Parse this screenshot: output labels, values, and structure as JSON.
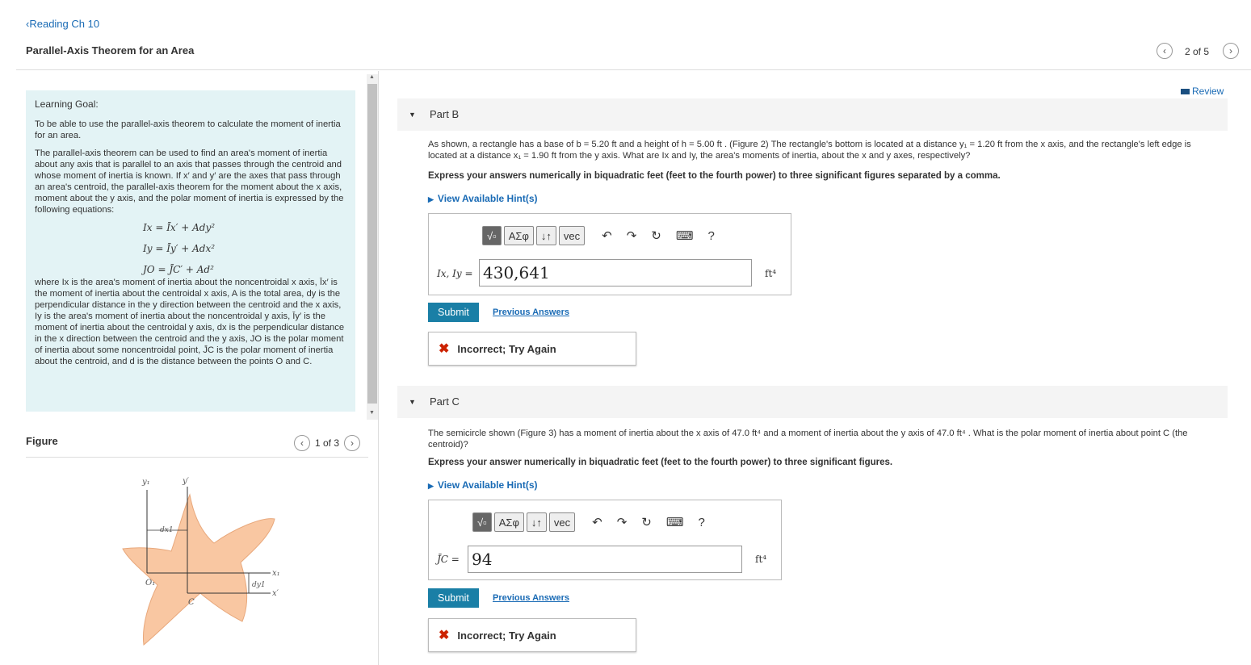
{
  "header": {
    "breadcrumb": "Reading Ch 10",
    "title": "Parallel-Axis Theorem for an Area",
    "pager": "2 of 5"
  },
  "review_label": "Review",
  "goal": {
    "title": "Learning Goal:",
    "p1": "To be able to use the parallel-axis theorem to calculate the moment of inertia for an area.",
    "p2": "The parallel-axis theorem can be used to find an area's moment of inertia about any axis that is parallel to an axis that passes through the centroid and whose moment of inertia is known. If x′ and y′ are the axes that pass through an area's centroid, the parallel-axis theorem for the moment about the x axis, moment about the y axis, and the polar moment of inertia is expressed by the following equations:",
    "eq1": "Ix = Īx′ + Ady²",
    "eq2": "Iy = Īy′ + Adx²",
    "eq3": "JO = J̄C′ + Ad²",
    "p3": "where Ix is the area's moment of inertia about the noncentroidal x axis, Īx′ is the moment of inertia about the centroidal x axis, A is the total area, dy is the perpendicular distance in the y direction between the centroid and the x axis, Iy is the area's moment of inertia about the noncentroidal y axis, Īy′ is the moment of inertia about the centroidal y axis, dx is the perpendicular distance in the x direction between the centroid and the y axis, JO is the polar moment of inertia about some noncentroidal point, J̄C is the polar moment of inertia about the centroid, and d is the distance between the points O and C."
  },
  "figure": {
    "heading": "Figure",
    "pager": "1 of 3",
    "labels": {
      "y1": "y₁",
      "yp": "y′",
      "dx1": "dx1",
      "dy1": "dy1",
      "x1": "x₁",
      "xp": "x′",
      "o1": "O₁",
      "c": "C"
    }
  },
  "partB": {
    "label": "Part B",
    "question": "As shown, a rectangle has a base of b = 5.20 ft and a height of h = 5.00 ft . (Figure 2) The rectangle's bottom is located at a distance y₁ = 1.20 ft from the x axis, and the rectangle's left edge is located at a distance x₁ = 1.90 ft from the y axis. What are Ix and Iy, the area's moments of inertia, about the x and y axes, respectively?",
    "instructions": "Express your answers numerically in biquadratic feet (feet to the fourth power) to three significant figures separated by a comma.",
    "hint": "View Available Hint(s)",
    "answer_label": "Ix, Iy =",
    "answer_value": "430,641",
    "unit": "ft⁴",
    "submit": "Submit",
    "previous": "Previous Answers",
    "feedback": "Incorrect; Try Again"
  },
  "partC": {
    "label": "Part C",
    "question": "The semicircle shown (Figure 3) has a moment of inertia about the x axis of 47.0 ft⁴ and a moment of inertia about the y axis of 47.0 ft⁴ . What is the polar moment of inertia about point C (the centroid)?",
    "instructions": "Express your answer numerically in biquadratic feet (feet to the fourth power) to three significant figures.",
    "hint": "View Available Hint(s)",
    "answer_label": "J̄C =",
    "answer_value": "94",
    "unit": "ft⁴",
    "submit": "Submit",
    "previous": "Previous Answers",
    "feedback": "Incorrect; Try Again"
  },
  "toolbar": {
    "templates": "√▫",
    "greek": "ΑΣφ",
    "updown": "↓↑",
    "vec": "vec",
    "help": "?"
  },
  "colors": {
    "accent": "#1a6bb5",
    "submit": "#1a7fa6",
    "goal_bg": "#e3f3f5",
    "shape": "#f9c7a2",
    "error": "#cc2200"
  }
}
